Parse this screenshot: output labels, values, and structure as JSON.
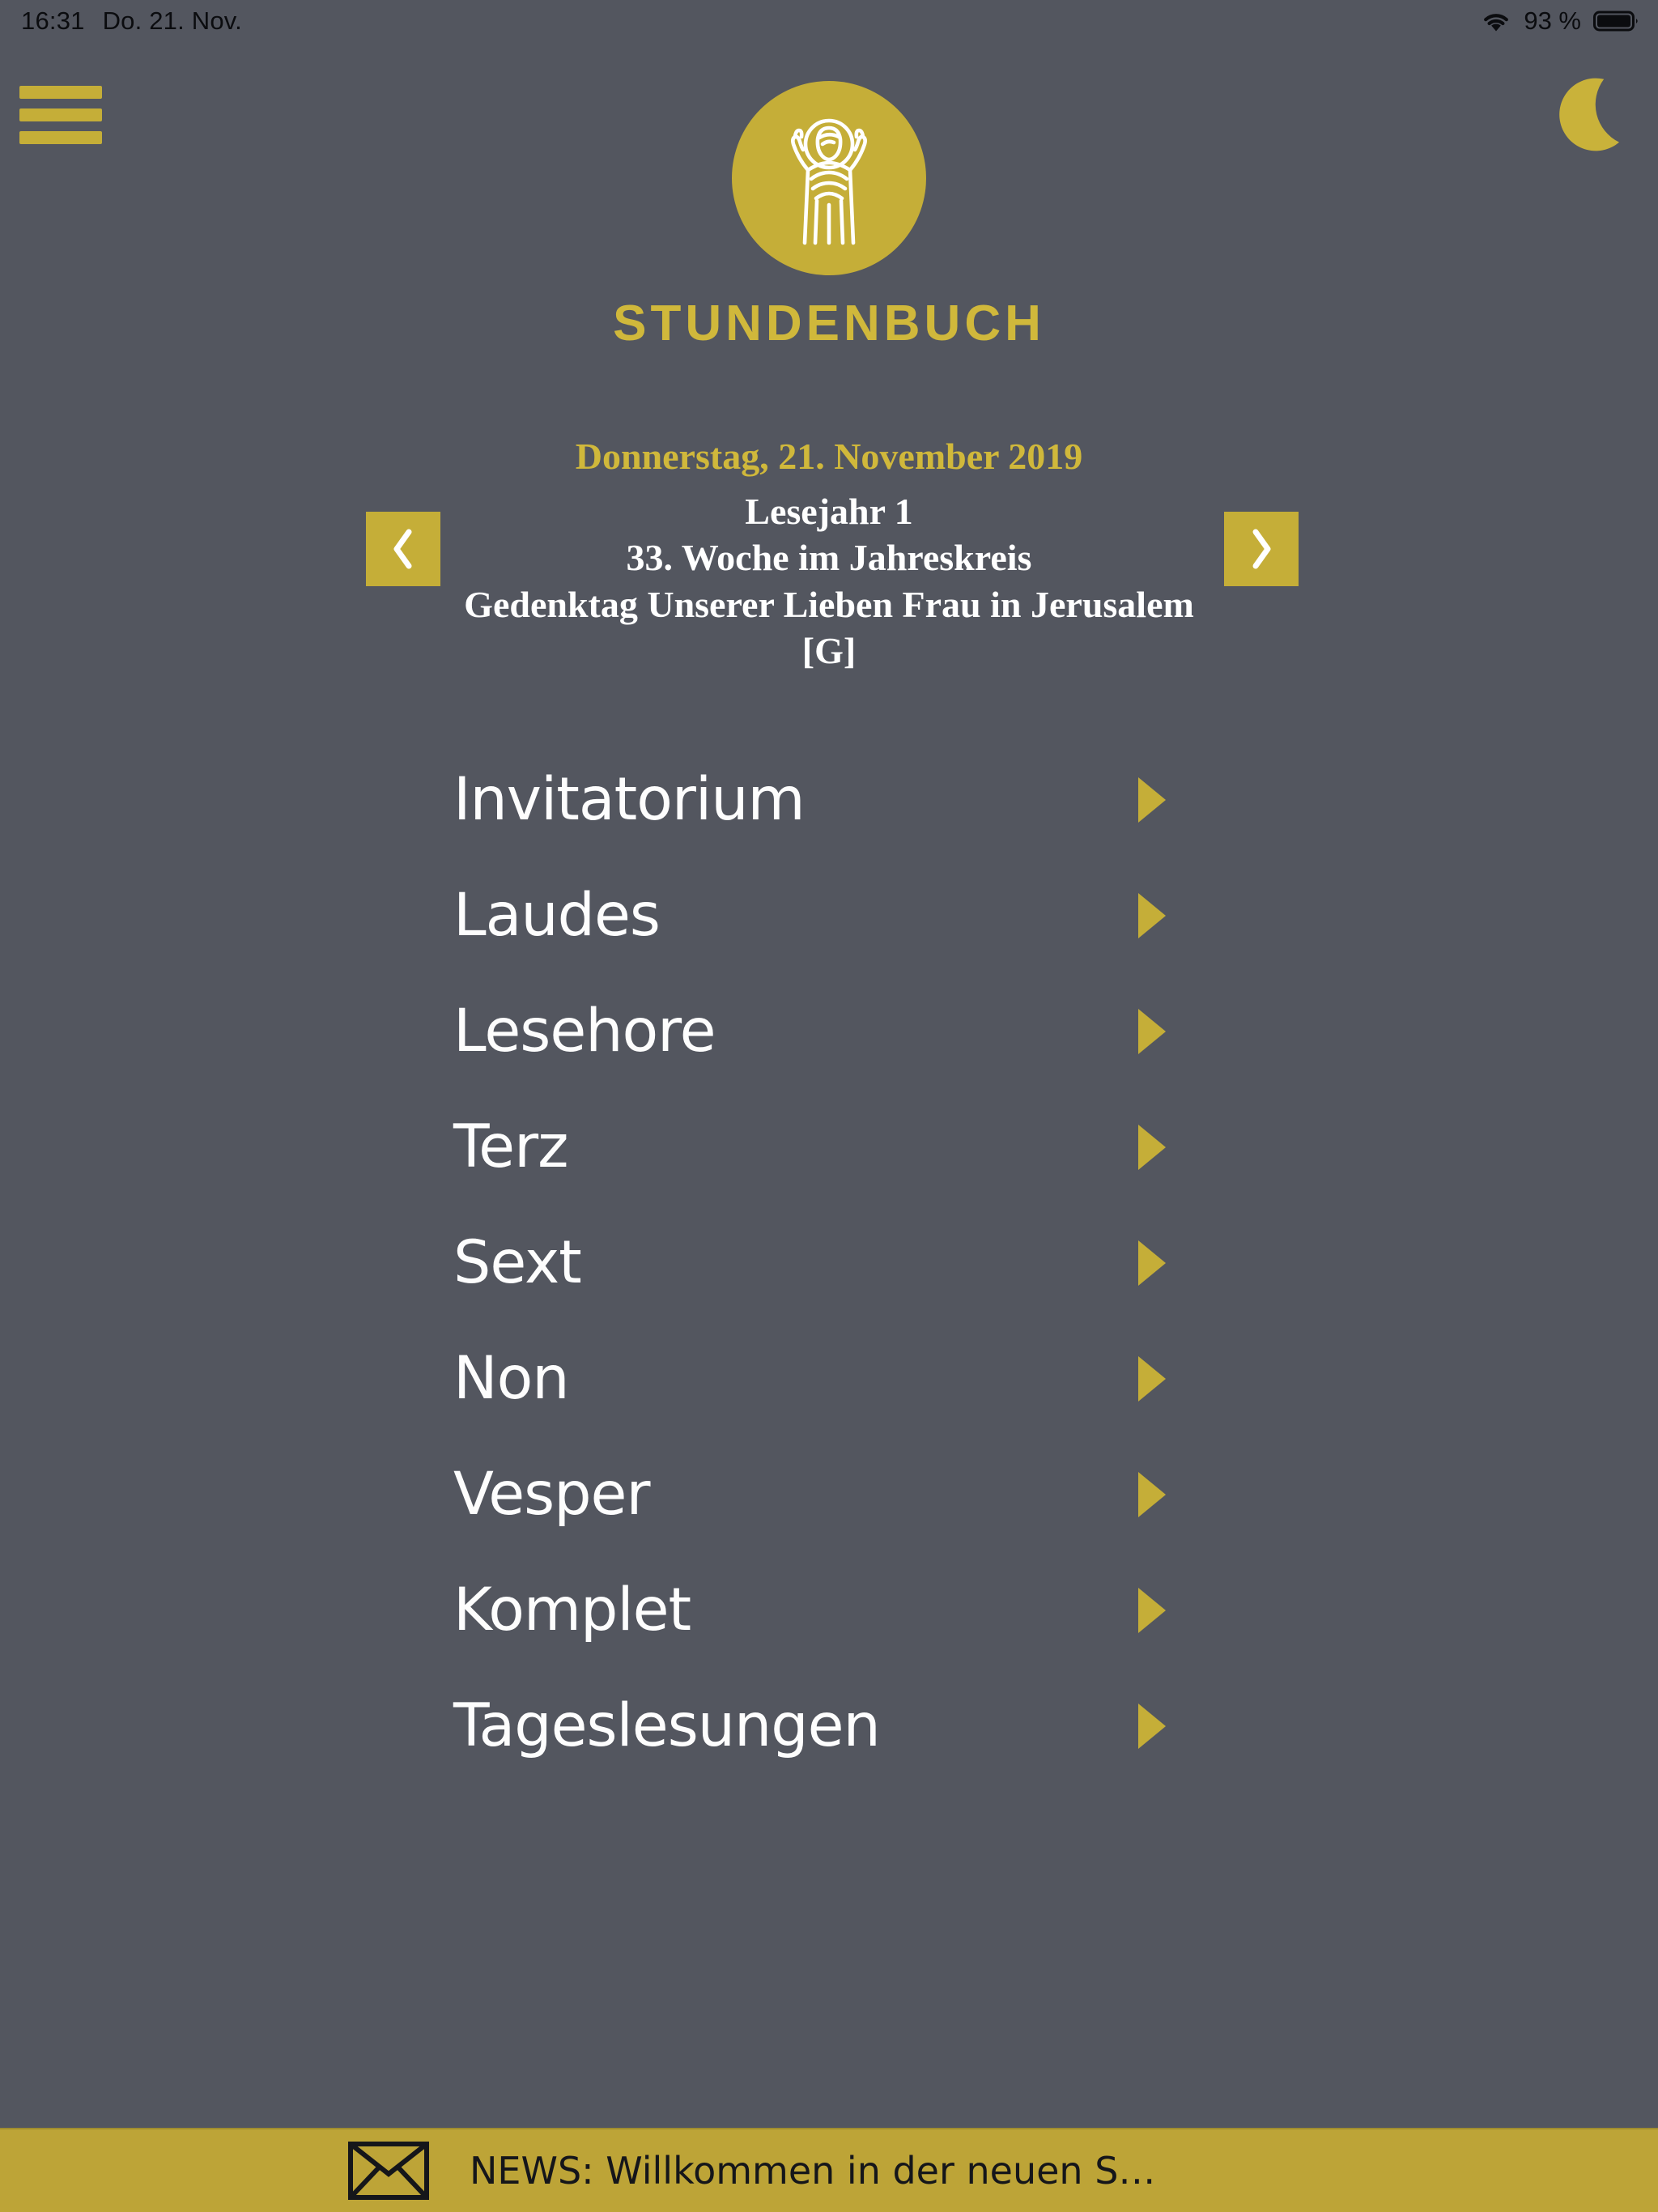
{
  "status_bar": {
    "time": "16:31",
    "date": "Do. 21. Nov.",
    "battery_percent": "93 %",
    "wifi_icon": "wifi-icon",
    "battery_icon": "battery-full-icon"
  },
  "header": {
    "menu_icon": "hamburger-menu-icon",
    "night_mode_icon": "crescent-moon-icon",
    "logo_icon": "orans-figure-logo-icon",
    "app_title": "STUNDENBUCH"
  },
  "date_block": {
    "date": "Donnerstag, 21. November 2019",
    "reading_year": "Lesejahr 1",
    "week": "33. Woche im Jahreskreis",
    "feast": "Gedenktag Unserer Lieben Frau in Jerusalem",
    "rank": "[G]",
    "prev_label": "‹",
    "next_label": "›",
    "prev_icon": "chevron-left-icon",
    "next_icon": "chevron-right-icon"
  },
  "hours": [
    {
      "label": "Invitatorium",
      "arrow_icon": "chevron-right-triangle-icon"
    },
    {
      "label": "Laudes",
      "arrow_icon": "chevron-right-triangle-icon"
    },
    {
      "label": "Lesehore",
      "arrow_icon": "chevron-right-triangle-icon"
    },
    {
      "label": "Terz",
      "arrow_icon": "chevron-right-triangle-icon"
    },
    {
      "label": "Sext",
      "arrow_icon": "chevron-right-triangle-icon"
    },
    {
      "label": "Non",
      "arrow_icon": "chevron-right-triangle-icon"
    },
    {
      "label": "Vesper",
      "arrow_icon": "chevron-right-triangle-icon"
    },
    {
      "label": "Komplet",
      "arrow_icon": "chevron-right-triangle-icon"
    },
    {
      "label": "Tageslesungen",
      "arrow_icon": "chevron-right-triangle-icon"
    }
  ],
  "news_bar": {
    "icon": "envelope-icon",
    "text": "NEWS: Willkommen in der neuen S…"
  },
  "colors": {
    "background": "#53565f",
    "gold": "#c5ae38",
    "gold_title": "#d0b83b",
    "gold_bar": "#bda437",
    "text_light": "#ffffff",
    "text_dark": "#15161a"
  }
}
